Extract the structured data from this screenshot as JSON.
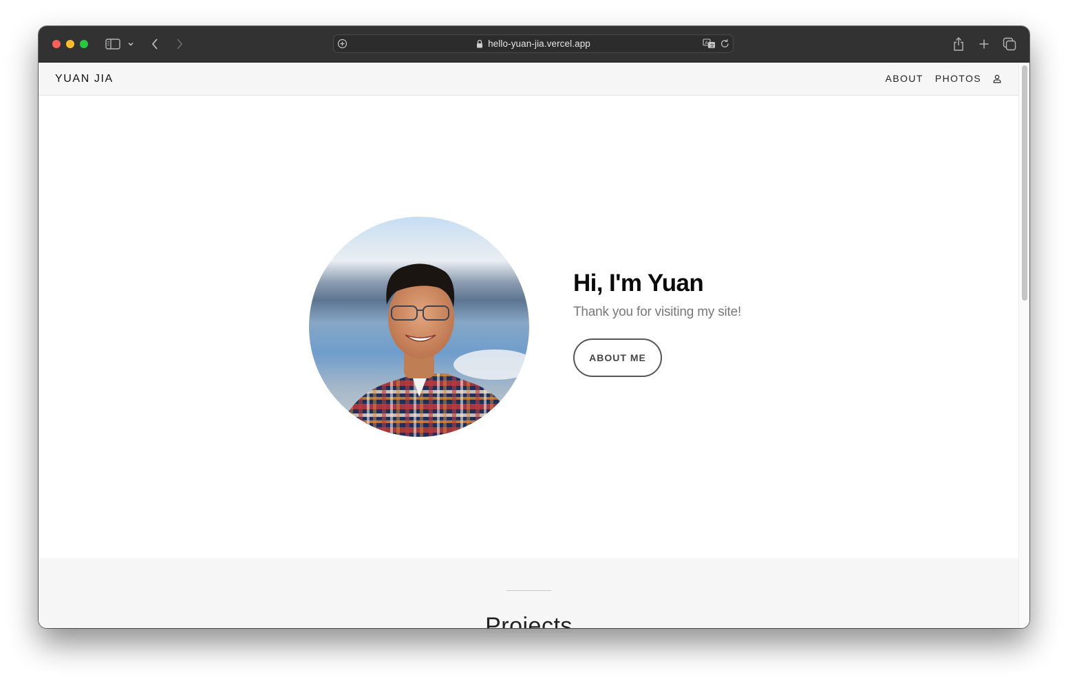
{
  "browser": {
    "url": "hello-yuan-jia.vercel.app",
    "traffic_lights": {
      "close": "#fe5f57",
      "minimize": "#febc2e",
      "zoom": "#28c840"
    },
    "icons": {
      "sidebar": "sidebar-icon",
      "chevron": "chevron-down-icon",
      "back": "chevron-left-icon",
      "forward": "chevron-right-icon",
      "site_settings": "plus-circle-icon",
      "lock": "lock-icon",
      "translate": "translate-icon",
      "reload": "reload-icon",
      "share": "share-icon",
      "new_tab": "plus-icon",
      "tabs_overview": "tabs-icon"
    }
  },
  "site": {
    "brand": "YUAN JIA",
    "nav": {
      "links": [
        {
          "label": "ABOUT"
        },
        {
          "label": "PHOTOS"
        }
      ],
      "user_icon": "user-icon"
    },
    "hero": {
      "title": "Hi, I'm Yuan",
      "subtitle": "Thank you for visiting my site!",
      "button_label": "ABOUT ME",
      "avatar_alt": "Portrait photo of Yuan"
    },
    "projects": {
      "title": "Projects"
    }
  }
}
